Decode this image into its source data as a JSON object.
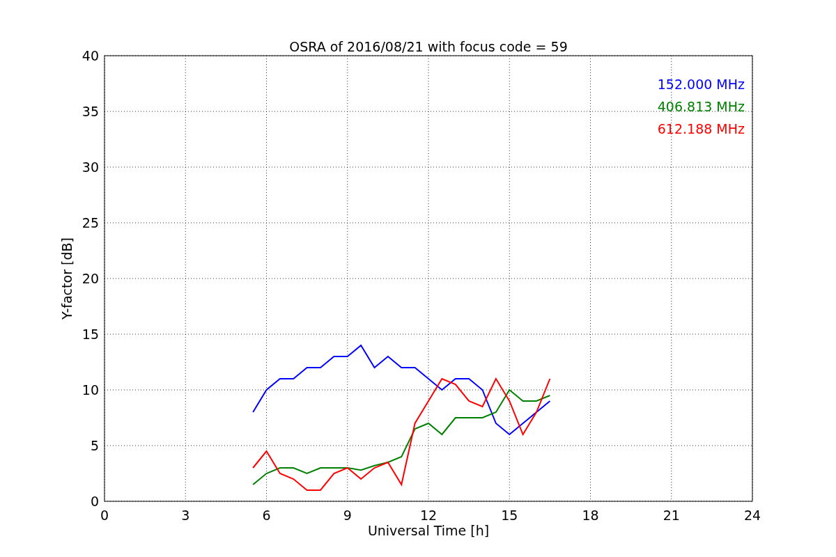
{
  "chart_data": {
    "type": "line",
    "title": "OSRA of 2016/08/21 with focus code = 59",
    "xlabel": "Universal Time [h]",
    "ylabel": "Y-factor [dB]",
    "x": [
      5.5,
      6,
      6.5,
      7,
      7.5,
      8,
      8.5,
      9,
      9.5,
      10,
      10.5,
      11,
      11.5,
      12,
      12.5,
      13,
      13.5,
      14,
      14.5,
      15,
      15.5,
      16,
      16.5
    ],
    "series": [
      {
        "name": "152.000 MHz",
        "color": "#0000ff",
        "values": [
          8,
          10,
          11,
          11,
          12,
          12,
          13,
          13,
          14,
          12,
          13,
          12,
          12,
          11,
          10,
          11,
          11,
          10,
          7,
          6,
          7,
          8,
          9
        ]
      },
      {
        "name": "406.813 MHz",
        "color": "#008000",
        "values": [
          1.5,
          2.5,
          3,
          3,
          2.5,
          3,
          3,
          3,
          2.8,
          3.2,
          3.5,
          4,
          6.5,
          7,
          6,
          7.5,
          7.5,
          7.5,
          8,
          10,
          9,
          9,
          9.5
        ]
      },
      {
        "name": "612.188 MHz",
        "color": "#ff0000",
        "values": [
          3,
          4.5,
          2.5,
          2,
          1,
          1,
          2.5,
          3,
          2,
          3,
          3.5,
          1.5,
          7,
          9,
          11,
          10.5,
          9,
          8.5,
          11,
          9,
          6,
          8,
          11
        ]
      }
    ],
    "xlim": [
      0,
      24
    ],
    "ylim": [
      0,
      40
    ],
    "xticks": [
      0,
      3,
      6,
      9,
      12,
      15,
      18,
      21,
      24
    ],
    "yticks": [
      0,
      5,
      10,
      15,
      20,
      25,
      30,
      35,
      40
    ],
    "grid": true
  }
}
